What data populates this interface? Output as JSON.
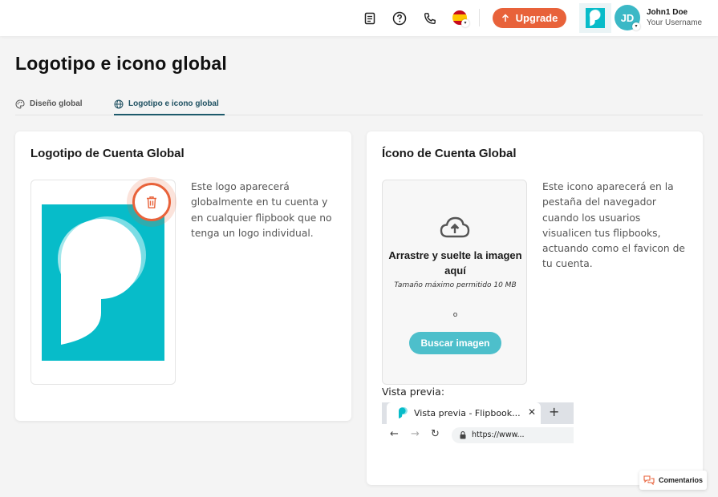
{
  "header": {
    "upgrade_label": "Upgrade",
    "user_initials": "JD",
    "user_name": "John1 Doe",
    "user_subtitle": "Your Username",
    "icons": [
      "document-icon",
      "help-icon",
      "phone-icon",
      "flag-es-icon"
    ]
  },
  "page": {
    "title": "Logotipo e icono global"
  },
  "tabs": [
    {
      "label": "Diseño global",
      "icon": "palette-icon",
      "active": false
    },
    {
      "label": "Logotipo e icono global",
      "icon": "globe-icon",
      "active": true
    }
  ],
  "logo_card": {
    "title": "Logotipo de Cuenta Global",
    "description": "Este logo aparecerá globalmente en tu cuenta y en cualquier flipbook que no tenga un logo individual."
  },
  "icon_card": {
    "title": "Ícono de Cuenta Global",
    "description": "Este icono aparecerá en la pestaña del navegador cuando los usuarios visualicen tus flipbooks, actuando como el favicon de tu cuenta.",
    "drop_title": "Arrastre y suelte la imagen aquí",
    "drop_hint": "Tamaño máximo permitido 10 MB",
    "drop_separator": "o",
    "browse_label": "Buscar imagen",
    "preview_label": "Vista previa:",
    "preview_tab_title": "Vista previa - Flipbook...",
    "preview_url": "https://www..."
  },
  "feedback_label": "Comentarios",
  "colors": {
    "accent_orange": "#e8623a",
    "brand_teal": "#07bcc9",
    "button_teal": "#4dbfcb",
    "tab_active": "#1d5a6b"
  }
}
